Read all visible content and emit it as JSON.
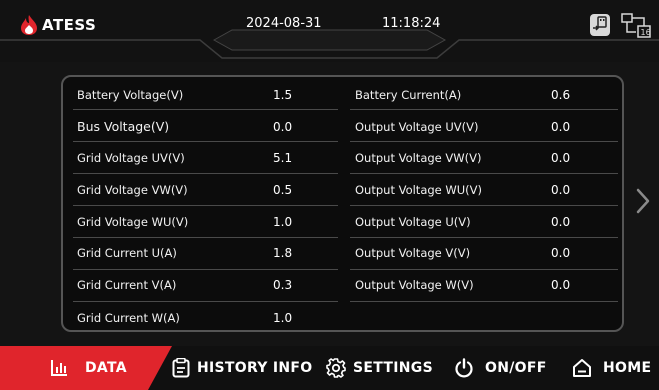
{
  "header": {
    "logo_text": "ATESS",
    "date": "2024-08-31",
    "time": "11:18:24",
    "accent_color": "#e0252c"
  },
  "data_panel": {
    "left_column": [
      {
        "label": "Battery Voltage(V)",
        "value": "1.5"
      },
      {
        "label": "Bus Voltage(V)",
        "value": "0.0"
      },
      {
        "label": "Grid Voltage UV(V)",
        "value": "5.1"
      },
      {
        "label": "Grid Voltage VW(V)",
        "value": "0.5"
      },
      {
        "label": "Grid Voltage WU(V)",
        "value": "1.0"
      },
      {
        "label": "Grid Current U(A)",
        "value": "1.8"
      },
      {
        "label": "Grid Current V(A)",
        "value": "0.3"
      },
      {
        "label": "Grid Current W(A)",
        "value": "1.0"
      }
    ],
    "right_column": [
      {
        "label": "Battery Current(A)",
        "value": "0.6"
      },
      {
        "label": "Output Voltage UV(V)",
        "value": "0.0"
      },
      {
        "label": "Output Voltage VW(V)",
        "value": "0.0"
      },
      {
        "label": "Output Voltage WU(V)",
        "value": "0.0"
      },
      {
        "label": "Output Voltage U(V)",
        "value": "0.0"
      },
      {
        "label": "Output Voltage V(V)",
        "value": "0.0"
      },
      {
        "label": "Output Voltage W(V)",
        "value": "0.0"
      }
    ]
  },
  "nav": {
    "items": [
      {
        "label": "DATA",
        "icon": "bar-chart-icon",
        "active": true
      },
      {
        "label": "HISTORY INFO",
        "icon": "document-icon",
        "active": false
      },
      {
        "label": "SETTINGS",
        "icon": "gear-icon",
        "active": false
      },
      {
        "label": "ON/OFF",
        "icon": "power-icon",
        "active": false
      },
      {
        "label": "HOME",
        "icon": "home-icon",
        "active": false
      }
    ]
  },
  "icons": {
    "usb": "usb-drive-icon",
    "network": "network-icon",
    "next": "chevron-right-icon"
  }
}
